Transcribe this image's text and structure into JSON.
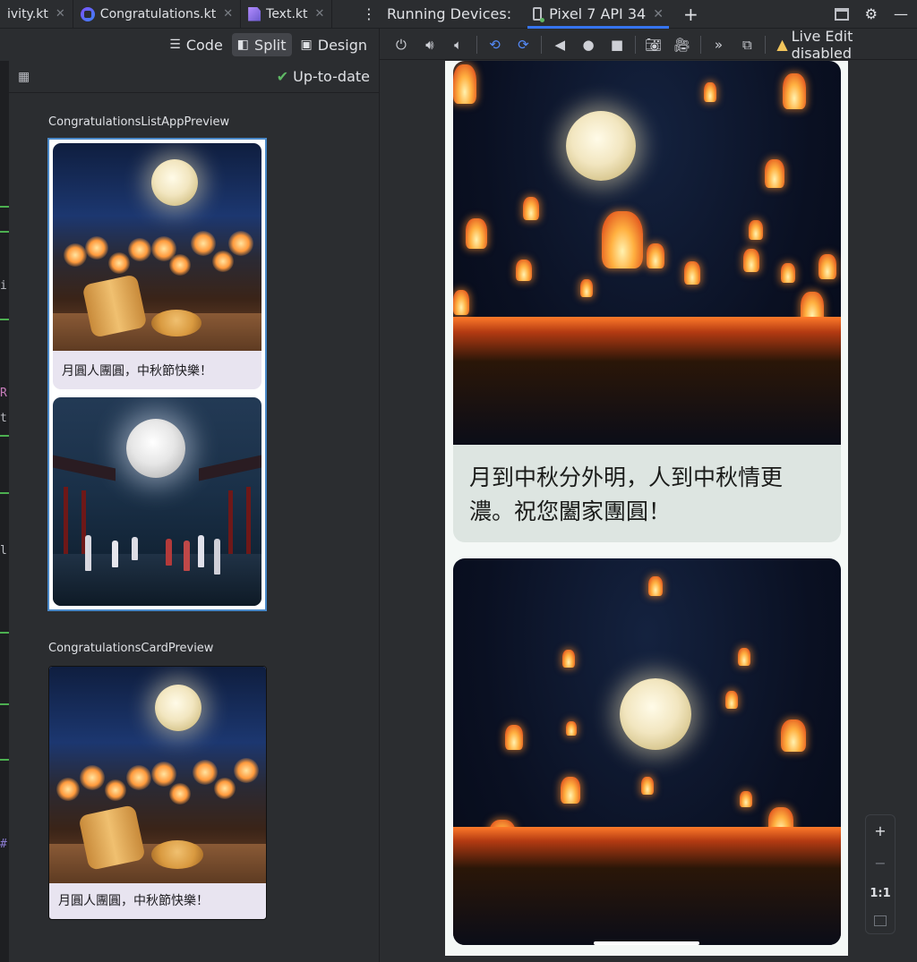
{
  "editor_tabs": [
    {
      "label": "ivity.kt"
    },
    {
      "label": "Congratulations.kt"
    },
    {
      "label": "Text.kt"
    }
  ],
  "view_modes": {
    "code": "Code",
    "split": "Split",
    "design": "Design"
  },
  "preview_status": "Up-to-date",
  "previews": {
    "list_title": "CongratulationsListAppPreview",
    "list_card_caption": "月圓人團圓，中秋節快樂！",
    "card_title": "CongratulationsCardPreview",
    "card_caption": "月圓人團圓，中秋節快樂！"
  },
  "gutter_chars": [
    "i",
    "R",
    "t",
    "l",
    "#"
  ],
  "running_devices": {
    "label": "Running Devices:",
    "device_tab": "Pixel 7 API 34",
    "live_edit": "Live Edit disabled"
  },
  "device_screen": {
    "card1_caption": "月到中秋分外明，人到中秋情更濃。祝您闔家團圓！"
  },
  "zoom_controls": {
    "plus": "+",
    "minus": "−",
    "one_to_one": "1:1"
  },
  "icons": [
    "kotlin-file-icon",
    "text-file-icon",
    "more-vertical-icon",
    "code-view-icon",
    "split-view-icon",
    "design-view-icon",
    "layout-grid-icon",
    "checkmark-icon",
    "phone-icon",
    "add-tab-icon",
    "window-icon",
    "settings-icon",
    "minimize-icon",
    "power-icon",
    "volume-up-icon",
    "volume-down-icon",
    "rotate-left-icon",
    "rotate-right-icon",
    "back-icon",
    "home-icon",
    "overview-icon",
    "camera-icon",
    "video-icon",
    "expand-more-icon",
    "mirror-icon",
    "warning-icon",
    "fit-screen-icon"
  ],
  "colors": {
    "accent": "#3574f0",
    "success": "#5fb865",
    "warning": "#f2c55c",
    "selection": "#4a88c7"
  }
}
